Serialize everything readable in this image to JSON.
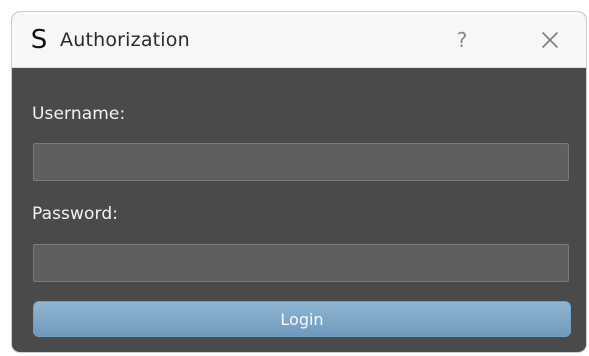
{
  "window": {
    "app_icon_letter": "S",
    "title": "Authorization",
    "help_label": "?",
    "close_label": "×"
  },
  "form": {
    "username_label": "Username:",
    "username_value": "",
    "username_placeholder": "",
    "password_label": "Password:",
    "password_value": "",
    "password_placeholder": "",
    "login_label": "Login"
  },
  "colors": {
    "titlebar_bg": "#f7f7f7",
    "content_bg": "#4a4a4a",
    "input_bg": "#5f5f5f",
    "button_bg_top": "#8fb6d4",
    "button_bg_bottom": "#6f99bc",
    "text_light": "#f2f2f2"
  }
}
